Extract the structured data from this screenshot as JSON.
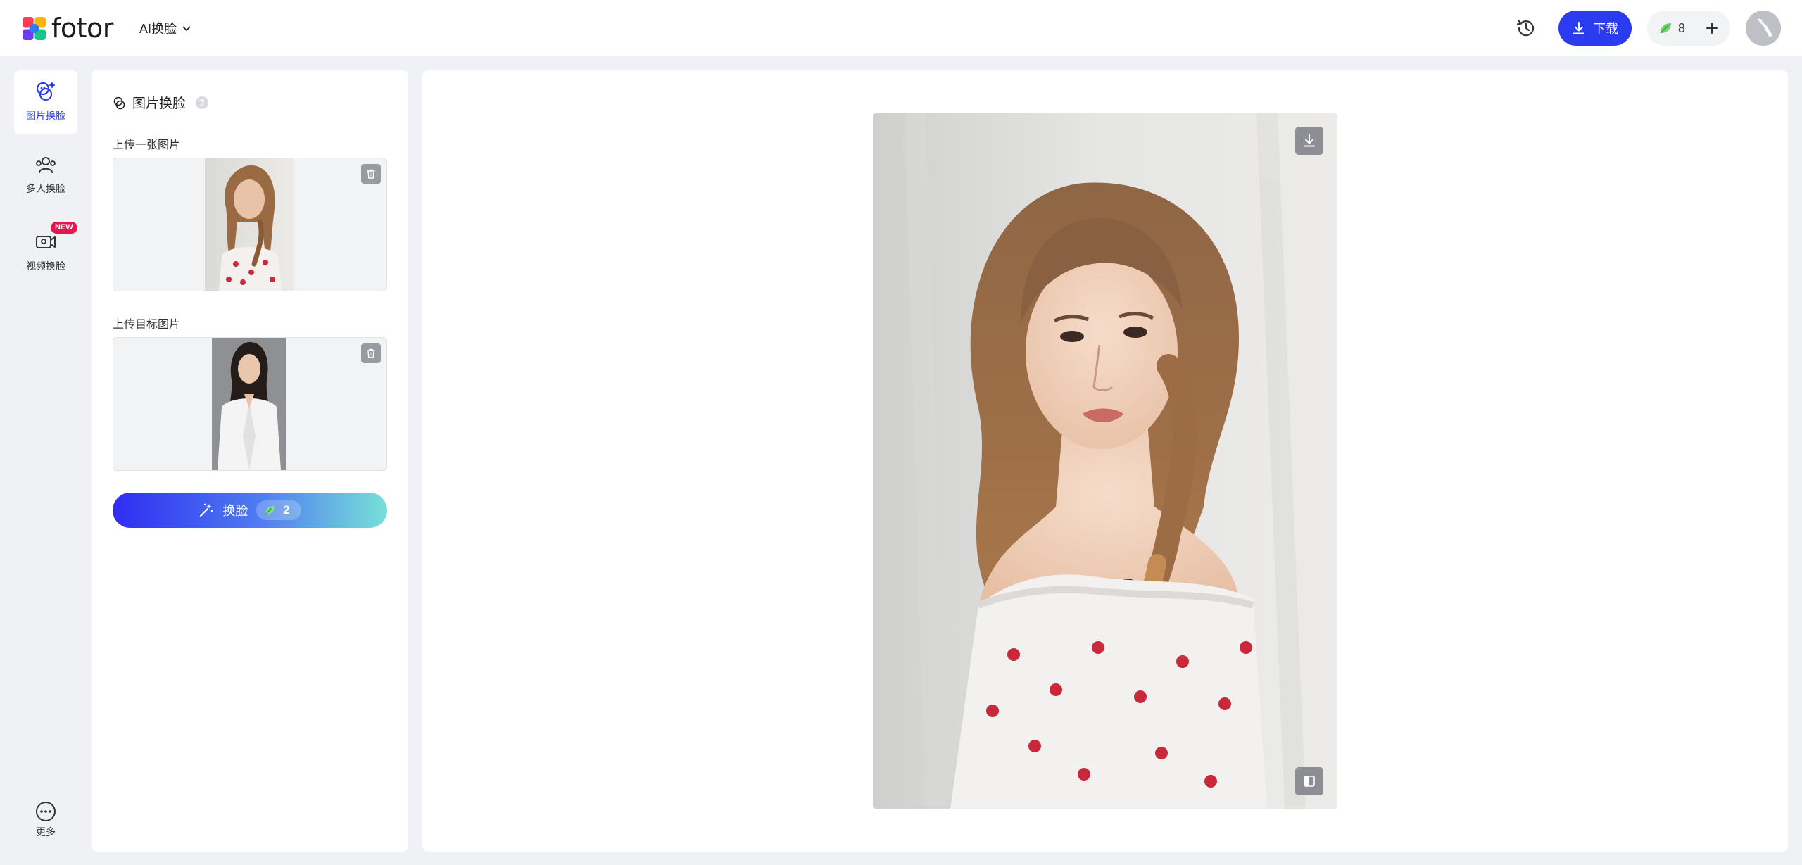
{
  "header": {
    "logo_text": "fotor",
    "mode_label": "AI换脸",
    "download_label": "下载",
    "credits": "8",
    "accent_color": "#2b3cf0"
  },
  "sidebar": {
    "items": [
      {
        "label": "图片换脸",
        "icon": "face-swap-icon",
        "active": true
      },
      {
        "label": "多人换脸",
        "icon": "multi-face-icon",
        "active": false
      },
      {
        "label": "视频换脸",
        "icon": "video-swap-icon",
        "active": false,
        "badge": "NEW"
      }
    ],
    "more_label": "更多"
  },
  "panel": {
    "title": "图片换脸",
    "help": "?",
    "source_label": "上传一张图片",
    "target_label": "上传目标图片",
    "swap_label": "换脸",
    "swap_cost": "2"
  },
  "preview": {
    "icons": [
      "download-icon",
      "compare-icon"
    ]
  }
}
